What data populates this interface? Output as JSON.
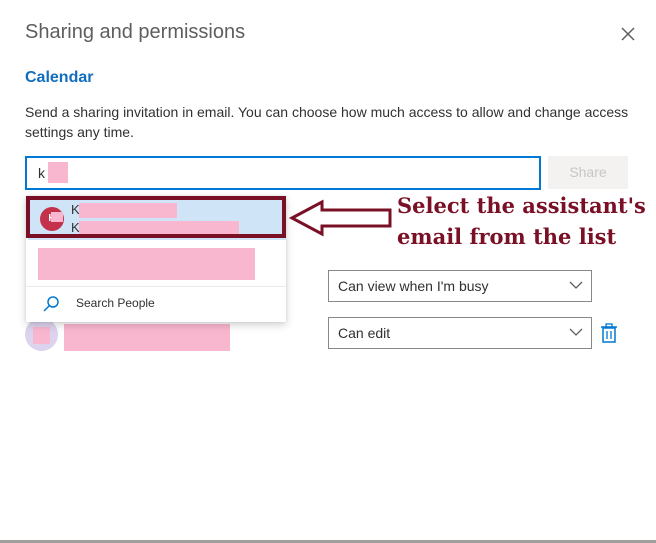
{
  "dialog": {
    "title": "Sharing and permissions",
    "calendar_label": "Calendar",
    "description": "Send a sharing invitation in email. You can choose how much access to allow and change access settings any time.",
    "search_value": "k",
    "share_label": "Share"
  },
  "suggestion": {
    "avatar_initials": "K",
    "name_prefix": "K",
    "email_prefix": "K"
  },
  "dropdown": {
    "search_people_label": "Search People"
  },
  "permissions": [
    {
      "value": "Can view when I'm busy"
    },
    {
      "value": "Can edit"
    }
  ],
  "annotation": {
    "text": "Select the assistant's email from the list",
    "color": "#7a1026"
  },
  "colors": {
    "accent": "#0078d4",
    "calendar_title": "#106ebe",
    "selected_row": "#cfe4f6",
    "redaction": "#f9b6cf",
    "avatar_red": "#c4314b"
  }
}
